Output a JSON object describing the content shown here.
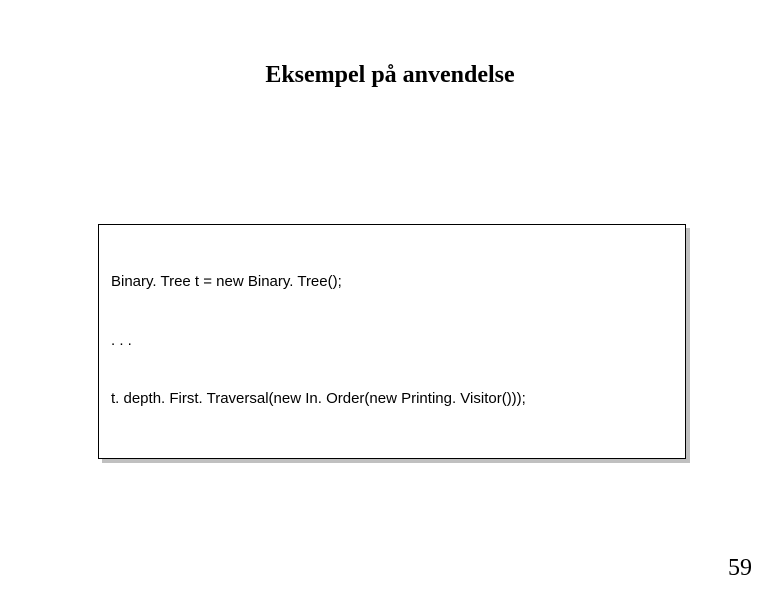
{
  "slide": {
    "title": "Eksempel på anvendelse",
    "page_number": "59"
  },
  "code": {
    "line1": "Binary. Tree t = new Binary. Tree();",
    "line2": ". . .",
    "line3": "t. depth. First. Traversal(new In. Order(new Printing. Visitor()));"
  }
}
